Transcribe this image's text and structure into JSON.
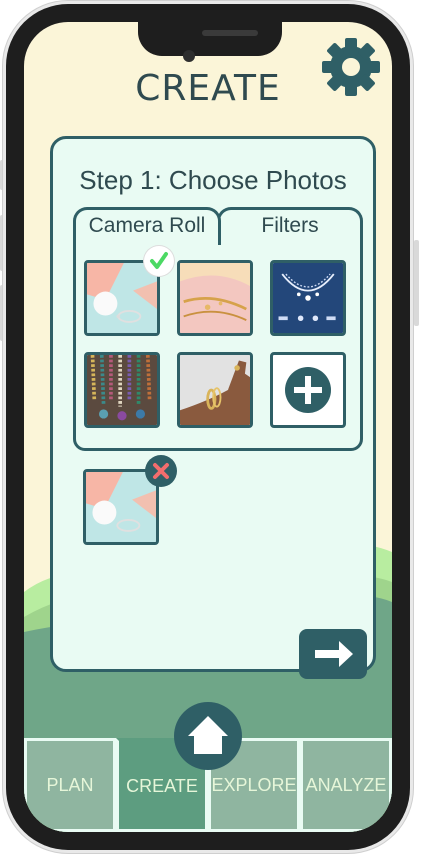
{
  "header": {
    "title": "CREATE",
    "settings_icon": "gear-icon"
  },
  "card": {
    "title": "Step 1: Choose Photos",
    "tabs": [
      {
        "label": "Camera Roll",
        "active": true
      },
      {
        "label": "Filters",
        "active": false
      }
    ],
    "photos": [
      {
        "name": "pastel-jewelry-photo",
        "selected": true
      },
      {
        "name": "gold-chain-photo",
        "selected": false
      },
      {
        "name": "diamond-necklace-photo",
        "selected": false
      },
      {
        "name": "beaded-necklaces-photo",
        "selected": false
      },
      {
        "name": "gold-bracelets-photo",
        "selected": false
      }
    ],
    "add_photo_icon": "plus-icon",
    "selected_preview": {
      "name": "pastel-jewelry-photo",
      "remove_icon": "close-icon"
    },
    "next_icon": "arrow-right-icon"
  },
  "nav": {
    "items": [
      {
        "label": "PLAN",
        "active": false
      },
      {
        "label": "CREATE",
        "active": true
      },
      {
        "label": "EXPLORE",
        "active": false
      },
      {
        "label": "ANALYZE",
        "active": false
      }
    ],
    "home_icon": "home-icon"
  },
  "colors": {
    "primary": "#2f5f66",
    "background": "#fbf5d8",
    "card": "#e9fbf3",
    "nav": "#8fb5a0",
    "nav_active": "#5d9d80",
    "check": "#4cd964",
    "remove": "#f26d6d"
  }
}
